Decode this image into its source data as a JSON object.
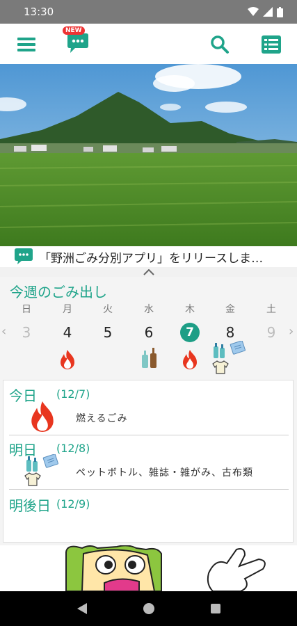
{
  "status": {
    "time": "13:30"
  },
  "app_bar": {
    "new_badge": "NEW"
  },
  "news": {
    "text": "「野洲ごみ分別アプリ」をリリースしま…"
  },
  "week": {
    "title": "今週のごみ出し",
    "weekdays": [
      "日",
      "月",
      "火",
      "水",
      "木",
      "金",
      "土"
    ],
    "dates": [
      "3",
      "4",
      "5",
      "6",
      "7",
      "8",
      "9"
    ]
  },
  "days": [
    {
      "label": "今日",
      "date": "(12/7)",
      "text": "燃えるごみ"
    },
    {
      "label": "明日",
      "date": "(12/8)",
      "text": "ペットボトル、雑誌・雑がみ、古布類"
    },
    {
      "label": "明後日",
      "date": "(12/9)",
      "text": ""
    }
  ],
  "colors": {
    "accent": "#1fa48a",
    "burnable": "#e8361f",
    "today_highlight": "#1d9e86"
  }
}
